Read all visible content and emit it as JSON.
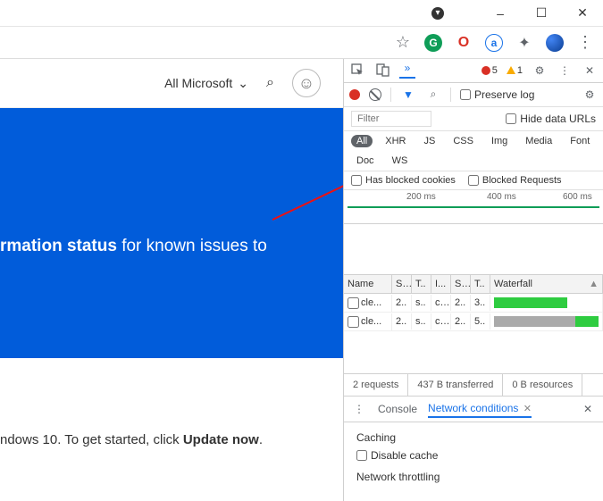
{
  "window": {
    "min": "–",
    "max": "☐",
    "close": "✕"
  },
  "extensions": {
    "star": "☆",
    "g": "G",
    "o": "O",
    "a": "a",
    "puzzle": "✦",
    "menu": "⋮"
  },
  "page": {
    "allMicrosoft": "All Microsoft",
    "bannerBold": "rmation status",
    "bannerRest": " for known issues to",
    "bottom1": "ndows 10. To get started, click ",
    "bottom2": "Update now",
    "bottom3": "."
  },
  "devtools": {
    "errCount": "5",
    "warnCount": "1",
    "preserveLog": "Preserve log",
    "hideDataUrls": "Hide data URLs",
    "filterPlaceholder": "Filter",
    "types": {
      "all": "All",
      "xhr": "XHR",
      "js": "JS",
      "css": "CSS",
      "img": "Img",
      "media": "Media",
      "font": "Font",
      "doc": "Doc",
      "ws": "WS"
    },
    "hasBlocked": "Has blocked cookies",
    "blockedReq": "Blocked Requests",
    "ticks": {
      "t200": "200 ms",
      "t400": "400 ms",
      "t600": "600 ms"
    },
    "cols": {
      "name": "Name",
      "s": "S..",
      "t": "T..",
      "i": "I...",
      "s2": "S..",
      "t2": "T..",
      "wf": "Waterfall"
    },
    "rows": [
      {
        "name": "cle...",
        "s": "2..",
        "t": "s..",
        "i": "c...",
        "s2": "2..",
        "t2": "3..",
        "wf": "g1"
      },
      {
        "name": "cle...",
        "s": "2..",
        "t": "s..",
        "i": "c...",
        "s2": "2..",
        "t2": "5..",
        "wf": "g2"
      }
    ],
    "status": {
      "reqs": "2 requests",
      "trans": "437 B transferred",
      "res": "0 B resources"
    },
    "drawer": {
      "console": "Console",
      "netcond": "Network conditions",
      "caching": "Caching",
      "disableCache": "Disable cache",
      "throttle": "Network throttling"
    }
  }
}
